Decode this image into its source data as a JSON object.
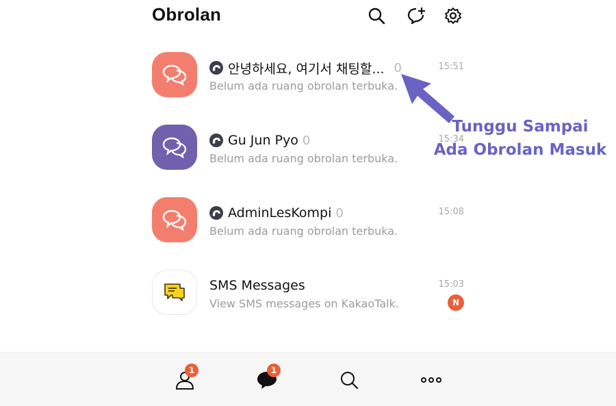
{
  "header": {
    "title": "Obrolan",
    "icons": [
      "search-icon",
      "new-chat-icon",
      "settings-icon"
    ]
  },
  "chats": [
    {
      "name": "안녕하세요, 여기서 채팅할...",
      "count": "0",
      "time": "15:51",
      "preview": "Belum ada ruang obrolan terbuka.",
      "avatar_color": "#f47e6e"
    },
    {
      "name": "Gu Jun Pyo",
      "count": "0",
      "time": "15:34",
      "preview": "Belum ada ruang obrolan terbuka.",
      "avatar_color": "#7060ad"
    },
    {
      "name": "AdminLesKompi",
      "count": "0",
      "time": "15:08",
      "preview": "Belum ada ruang obrolan terbuka.",
      "avatar_color": "#f47e6e"
    },
    {
      "name": "SMS Messages",
      "time": "15:03",
      "preview": "View SMS messages on KakaoTalk.",
      "badge": "N"
    }
  ],
  "bottom_nav": {
    "friends_badge": "1",
    "chats_badge": "1",
    "icons": [
      "friends-icon",
      "chats-icon",
      "search-icon",
      "more-icon"
    ]
  },
  "annotation": {
    "line1": "Tunggu Sampai",
    "line2": "Ada Obrolan Masuk",
    "color": "#6a63c4"
  },
  "colors": {
    "accent_badge": "#e8603a",
    "sms_icon": "#f7d21b"
  }
}
